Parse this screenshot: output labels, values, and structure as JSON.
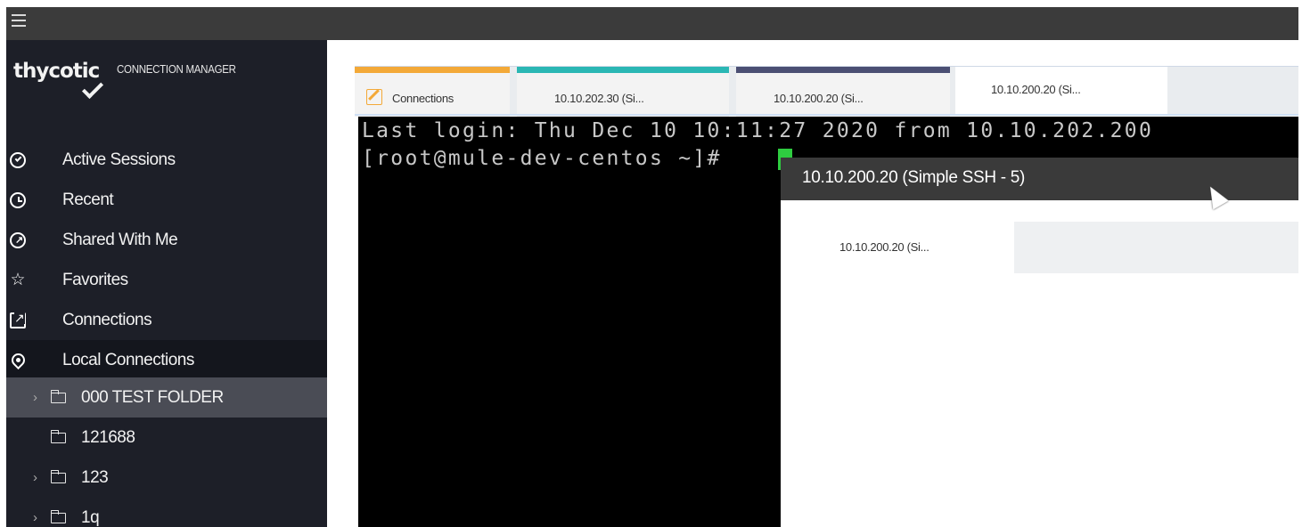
{
  "brand": {
    "name": "thycotic",
    "subtitle": "CONNECTION MANAGER"
  },
  "topbar": {
    "menu_icon": "hamburger-icon"
  },
  "sidebar": {
    "items": [
      {
        "label": "Active Sessions",
        "icon": "check-circle-icon"
      },
      {
        "label": "Recent",
        "icon": "clock-icon"
      },
      {
        "label": "Shared With Me",
        "icon": "share-circle-icon"
      },
      {
        "label": "Favorites",
        "icon": "star-icon"
      },
      {
        "label": "Connections",
        "icon": "external-link-icon"
      },
      {
        "label": "Local Connections",
        "icon": "location-pin-icon"
      }
    ],
    "tree": [
      {
        "label": "000 TEST FOLDER",
        "chevron": "›",
        "selected": true
      },
      {
        "label": "121688",
        "chevron": ""
      },
      {
        "label": "123",
        "chevron": "›"
      },
      {
        "label": "1q",
        "chevron": "›"
      }
    ]
  },
  "tabs": [
    {
      "label": "Connections"
    },
    {
      "label": "10.10.202.30 (Si..."
    },
    {
      "label": "10.10.200.20 (Si..."
    },
    {
      "label": "10.10.200.20 (Si..."
    }
  ],
  "terminal": {
    "line1": "Last login: Thu Dec 10 10:11:27 2020 from 10.10.202.200",
    "line2": "[root@mule-dev-centos ~]# "
  },
  "dialog": {
    "title": "10.10.200.20 (Simple SSH - 5)",
    "tab_label": "10.10.200.20 (Si..."
  },
  "colors": {
    "sidebar_bg": "#1d1f28",
    "tab_connections": "#f3a938",
    "tab_teal": "#2ab7b4",
    "tab_navy": "#4b4f73",
    "cursor": "#2ecc40"
  }
}
